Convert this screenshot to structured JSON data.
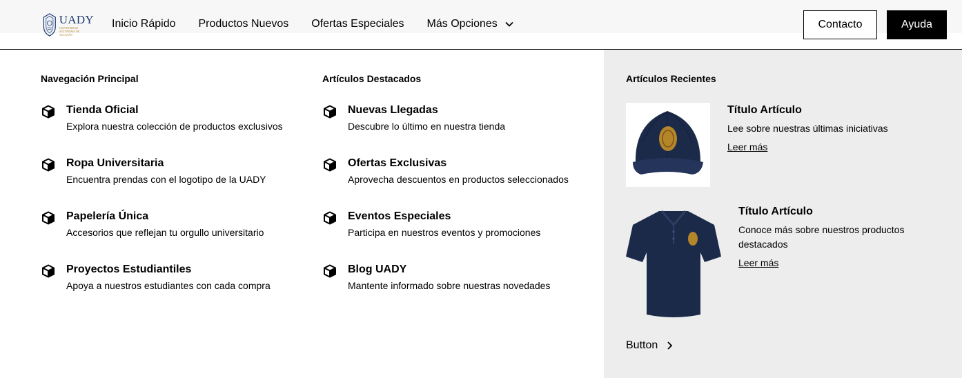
{
  "header": {
    "logo_text": "UADY",
    "logo_subtext": "UNIVERSIDAD AUTÓNOMA DE YUCATÁN",
    "nav_links": [
      {
        "label": "Inicio Rápido"
      },
      {
        "label": "Productos Nuevos"
      },
      {
        "label": "Ofertas Especiales"
      },
      {
        "label": "Más Opciones",
        "icon": "chevron-down-icon"
      }
    ],
    "contact_label": "Contacto",
    "help_label": "Ayuda"
  },
  "menu": {
    "column1": {
      "title": "Navegación Principal",
      "items": [
        {
          "icon": "cube-icon",
          "title": "Tienda Oficial",
          "desc": "Explora nuestra colección de productos exclusivos"
        },
        {
          "icon": "cube-icon",
          "title": "Ropa Universitaria",
          "desc": "Encuentra prendas con el logotipo de la UADY"
        },
        {
          "icon": "cube-icon",
          "title": "Papelería Única",
          "desc": "Accesorios que reflejan tu orgullo universitario"
        },
        {
          "icon": "cube-icon",
          "title": "Proyectos Estudiantiles",
          "desc": "Apoya a nuestros estudiantes con cada compra"
        }
      ]
    },
    "column2": {
      "title": "Artículos Destacados",
      "items": [
        {
          "icon": "cube-icon",
          "title": "Nuevas Llegadas",
          "desc": "Descubre lo último en nuestra tienda"
        },
        {
          "icon": "cube-icon",
          "title": "Ofertas Exclusivas",
          "desc": "Aprovecha descuentos en productos seleccionados"
        },
        {
          "icon": "cube-icon",
          "title": "Eventos Especiales",
          "desc": "Participa en nuestros eventos y promociones"
        },
        {
          "icon": "cube-icon",
          "title": "Blog UADY",
          "desc": "Mantente informado sobre nuestras novedades"
        }
      ]
    },
    "recent": {
      "title": "Artículos Recientes",
      "articles": [
        {
          "image": "navy-cap-photo",
          "title": "Título Artículo",
          "desc": "Lee sobre nuestras últimas iniciativas",
          "link": "Leer más"
        },
        {
          "image": "navy-polo-photo",
          "title": "Título Artículo",
          "desc": "Conoce más sobre nuestros productos destacados",
          "link": "Leer más"
        }
      ],
      "button_label": "Button",
      "button_icon": "chevron-right-icon"
    }
  },
  "colors": {
    "panel_bg": "#ededed",
    "brand_navy": "#1f3a6e",
    "brand_gold": "#b5852a",
    "product_navy": "#1c2a4a"
  }
}
